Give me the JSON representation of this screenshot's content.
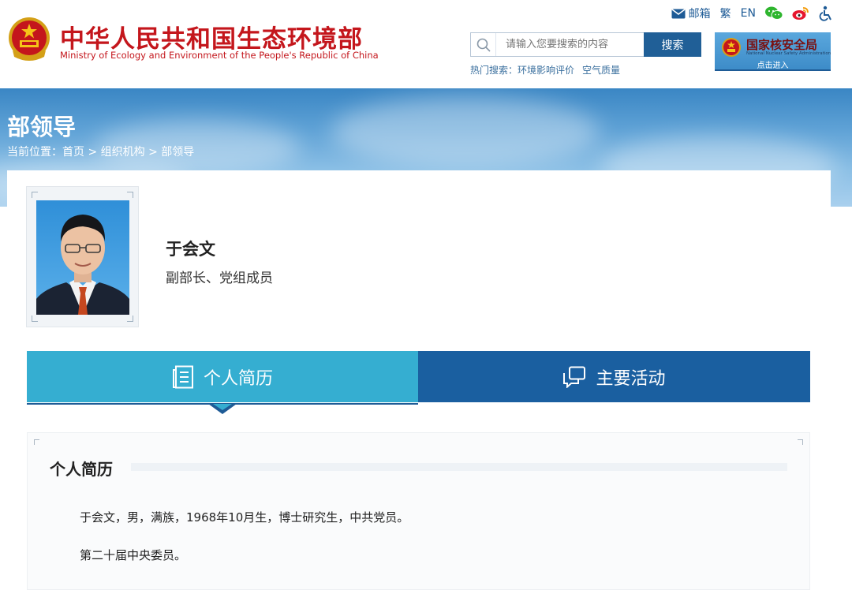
{
  "site": {
    "title_cn": "中华人民共和国生态环境部",
    "title_en": "Ministry of Ecology and Environment of the People's Republic of China",
    "brand_color": "#c4161c",
    "accent_color": "#1e5b96"
  },
  "toplinks": {
    "mail": "邮箱",
    "traditional": "繁",
    "english": "EN",
    "icons": [
      "mail-icon",
      "wechat-icon",
      "weibo-icon",
      "accessibility-icon"
    ]
  },
  "search": {
    "placeholder": "请输入您要搜索的内容",
    "button": "搜索",
    "hot_label": "热门搜索：",
    "hot_items": [
      "环境影响评价",
      "空气质量"
    ]
  },
  "nnsa": {
    "title": "国家核安全局",
    "subtitle": "National Nuclear Safety Administration",
    "enter": "点击进入"
  },
  "banner": {
    "title": "部领导",
    "breadcrumb_label": "当前位置：",
    "breadcrumb": [
      "首页",
      "组织机构",
      "部领导"
    ],
    "separator": ">"
  },
  "profile": {
    "name": "于会文",
    "position": "副部长、党组成员"
  },
  "tabs": [
    {
      "label": "个人简历",
      "active": true,
      "icon": "document-icon"
    },
    {
      "label": "主要活动",
      "active": false,
      "icon": "chat-icon"
    }
  ],
  "bio": {
    "heading": "个人简历",
    "paragraphs": [
      "于会文，男，满族，1968年10月生，博士研究生，中共党员。",
      "第二十届中央委员。"
    ]
  }
}
